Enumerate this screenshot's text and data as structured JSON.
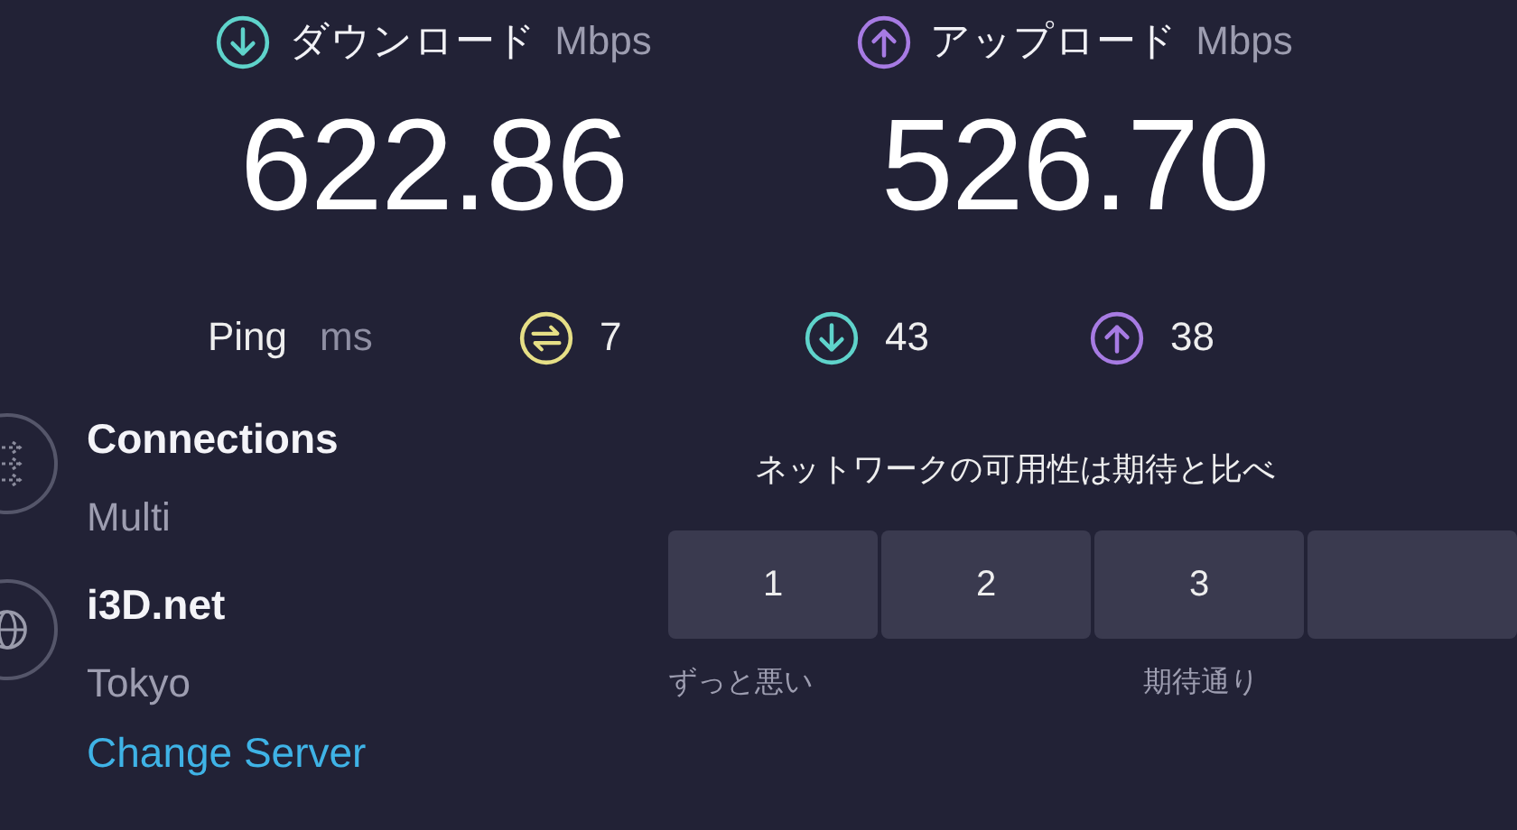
{
  "download": {
    "label": "ダウンロード",
    "unit": "Mbps",
    "value": "622.86"
  },
  "upload": {
    "label": "アップロード",
    "unit": "Mbps",
    "value": "526.70"
  },
  "ping": {
    "label": "Ping",
    "unit": "ms",
    "idle": "7",
    "download": "43",
    "upload": "38"
  },
  "connections": {
    "title": "Connections",
    "value": "Multi"
  },
  "server": {
    "name": "i3D.net",
    "location": "Tokyo",
    "link": "Change Server"
  },
  "survey": {
    "question": "ネットワークの可用性は期待と比べ",
    "ratings": [
      "1",
      "2",
      "3"
    ],
    "scale_labels": [
      "ずっと悪い",
      "期待通り"
    ]
  }
}
